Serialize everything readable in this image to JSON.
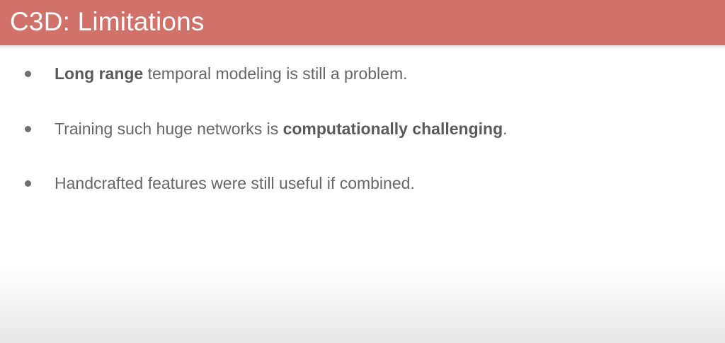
{
  "slide": {
    "title": "C3D: Limitations",
    "bullets": [
      {
        "bold": "Long range",
        "after": " temporal modeling is still a problem."
      },
      {
        "before": "Training such huge networks is ",
        "bold": "computationally challenging",
        "after": "."
      },
      {
        "before": "Handcrafted features were still useful if combined."
      }
    ]
  },
  "colors": {
    "title_bar": "#d0716a",
    "title_text": "#ffffff",
    "body_text": "#666666",
    "bullet_dot": "#6e6e6e"
  }
}
